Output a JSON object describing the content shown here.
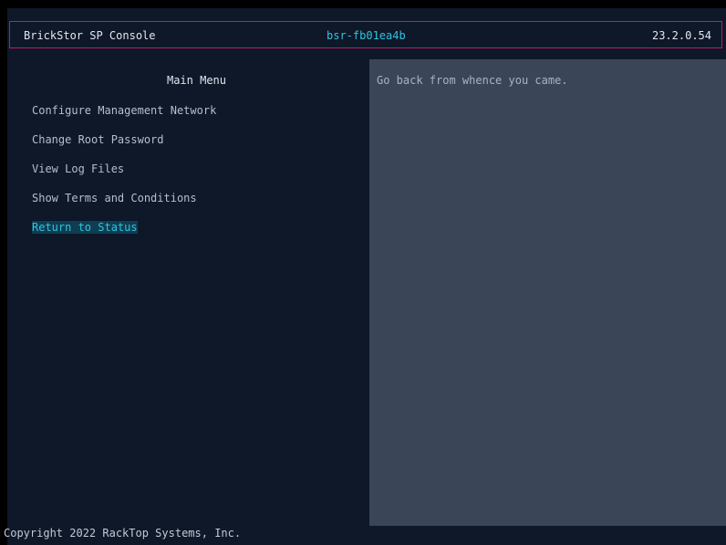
{
  "header": {
    "title": "BrickStor SP Console",
    "hostname": "bsr-fb01ea4b",
    "version": "23.2.0.54"
  },
  "menu": {
    "title": "Main Menu",
    "items": [
      {
        "label": "Configure Management Network"
      },
      {
        "label": "Change Root Password"
      },
      {
        "label": "View Log Files"
      },
      {
        "label": "Show Terms and Conditions"
      },
      {
        "label": "Return to Status",
        "selected": true
      }
    ]
  },
  "help": {
    "text": "Go back from whence you came."
  },
  "footer": {
    "copyright": "Copyright 2022 RackTop Systems, Inc."
  },
  "colors": {
    "background": "#0e1828",
    "panel": "#3b4558",
    "accent": "#2ec4e0",
    "border": "#c2186c"
  }
}
